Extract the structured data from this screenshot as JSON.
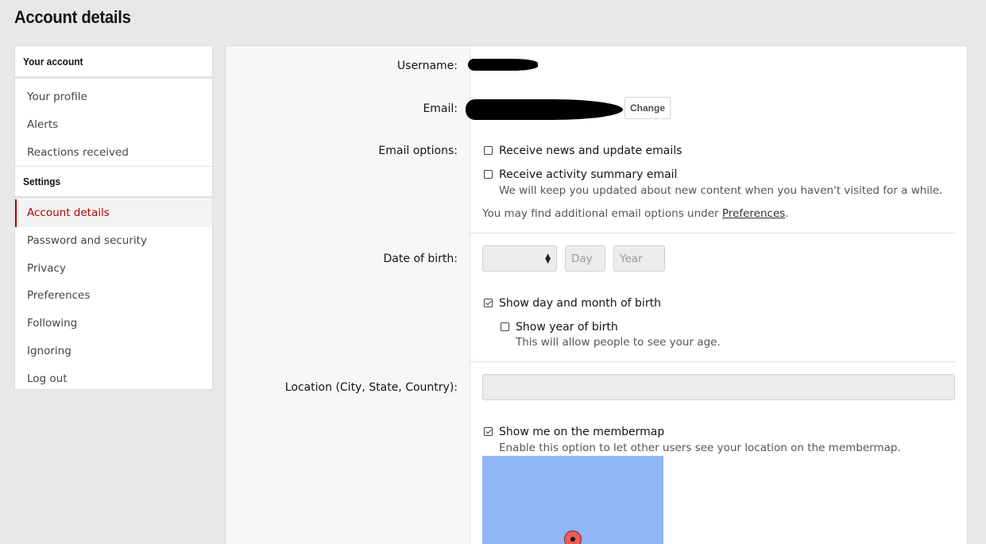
{
  "page": {
    "title": "Account details"
  },
  "sidebar": {
    "section1": "Your account",
    "items1": [
      "Your profile",
      "Alerts",
      "Reactions received"
    ],
    "section2": "Settings",
    "items2": [
      "Account details",
      "Password and security",
      "Privacy",
      "Preferences",
      "Following",
      "Ignoring",
      "Log out"
    ],
    "active": "Account details"
  },
  "form": {
    "username_label": "Username:",
    "email_label": "Email:",
    "change_button": "Change",
    "email_options_label": "Email options:",
    "opt_news": "Receive news and update emails",
    "opt_news_checked": false,
    "opt_summary": "Receive activity summary email",
    "opt_summary_checked": false,
    "opt_summary_hint": "We will keep you updated about new content when you haven't visited for a while.",
    "prefs_hint_prefix": "You may find additional email options under ",
    "prefs_link": "Preferences",
    "prefs_hint_suffix": ".",
    "dob_label": "Date of birth:",
    "dob_month_value": "",
    "dob_day_placeholder": "Day",
    "dob_year_placeholder": "Year",
    "show_dm": "Show day and month of birth",
    "show_dm_checked": true,
    "show_year": "Show year of birth",
    "show_year_checked": false,
    "show_year_hint": "This will allow people to see your age.",
    "location_label": "Location (City, State, Country):",
    "location_value": "",
    "membermap": "Show me on the membermap",
    "membermap_checked": true,
    "membermap_hint": "Enable this option to let other users see your location on the membermap."
  },
  "colors": {
    "accent": "#b40000",
    "map_water": "#90b6f4",
    "pin": "#ee5a5a"
  }
}
